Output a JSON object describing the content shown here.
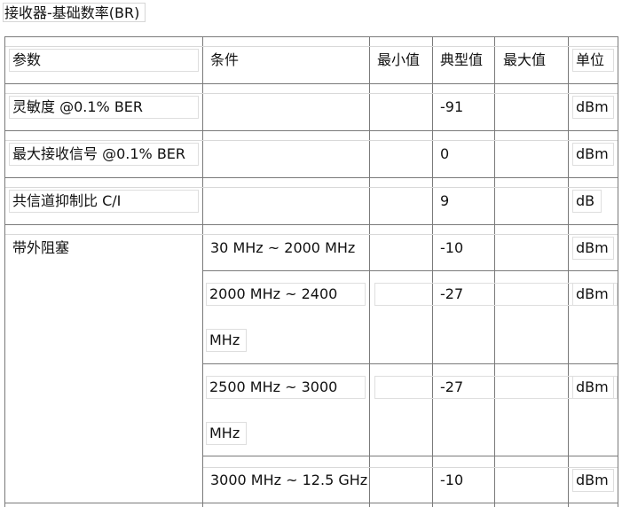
{
  "title": "接收器-基础数率(BR)",
  "header": {
    "param": "参数",
    "condition": "条件",
    "min": "最小值",
    "typ": "典型值",
    "max": "最大值",
    "unit": "单位"
  },
  "rows": [
    {
      "param": "灵敏度  @0.1% BER",
      "condition": "",
      "min": "",
      "typ": "-91",
      "max": "",
      "unit": "dBm"
    },
    {
      "param": "最大接收信号  @0.1% BER",
      "condition": "",
      "min": "",
      "typ": "0",
      "max": "",
      "unit": "dBm"
    },
    {
      "param": "共信道抑制比  C/I",
      "condition": "",
      "min": "",
      "typ": "9",
      "max": "",
      "unit": "dB"
    }
  ],
  "blocking": {
    "param": "带外阻塞",
    "items": [
      {
        "condition": "30 MHz ~ 2000 MHz",
        "typ": "-10",
        "unit": "dBm"
      },
      {
        "condition_line1": "2000   MHz   ~   2400",
        "condition_line2": "MHz",
        "typ": "-27",
        "unit": "dBm"
      },
      {
        "condition_line1": "2500   MHz   ~   3000",
        "condition_line2": "MHz",
        "typ": "-27",
        "unit": "dBm"
      },
      {
        "condition": "3000 MHz ~ 12.5 GHz",
        "typ": "-10",
        "unit": "dBm"
      }
    ]
  }
}
